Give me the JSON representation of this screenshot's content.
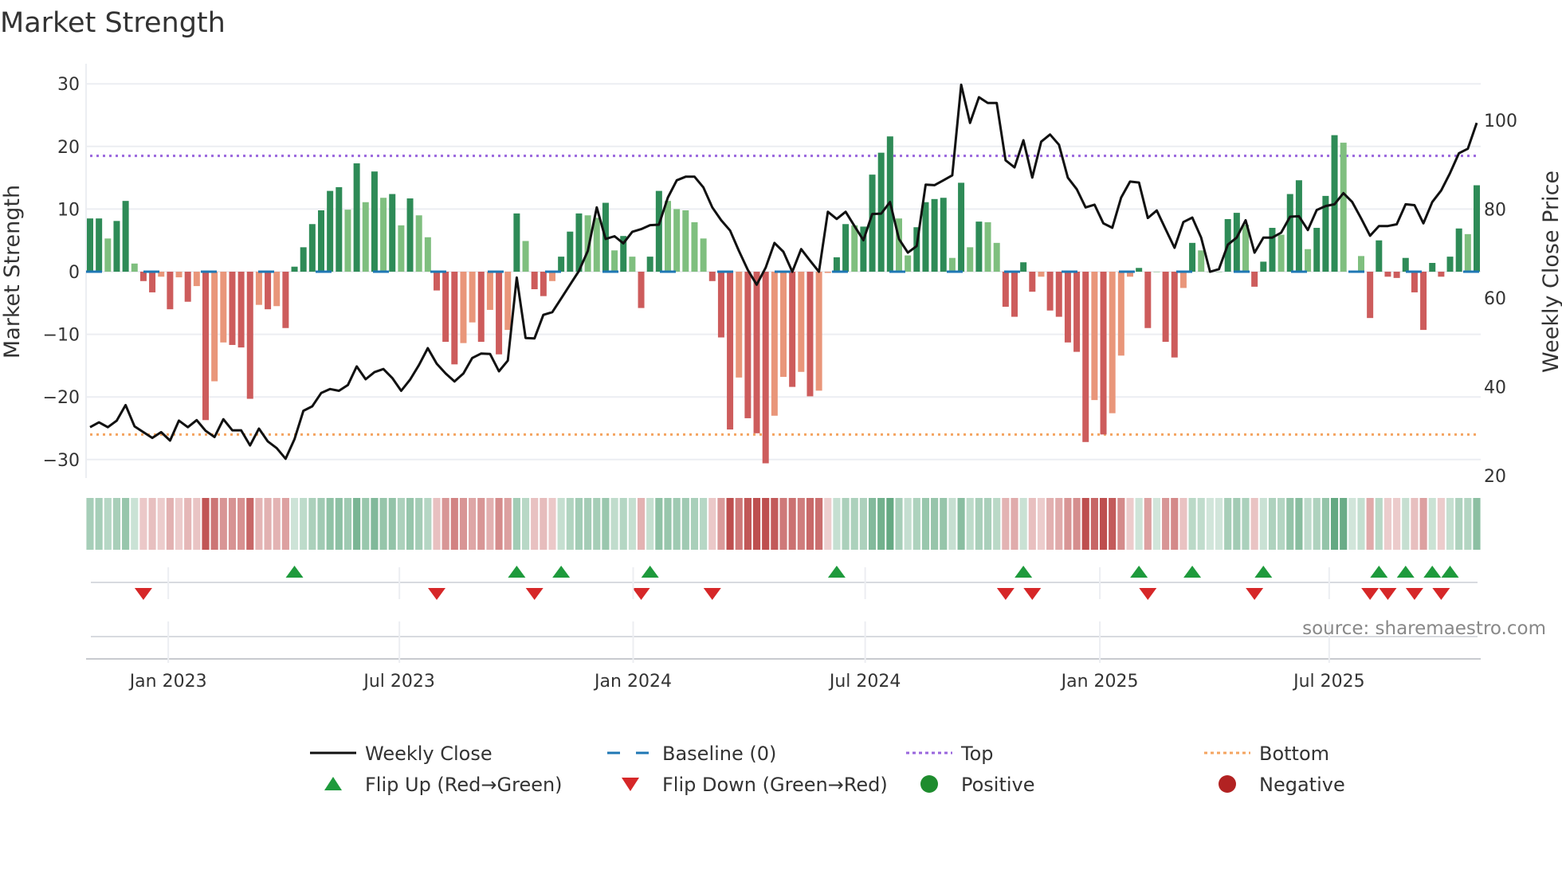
{
  "chart_data": {
    "type": "bar",
    "title": "Market Strength",
    "ylabel": "Market Strength",
    "y2label": "Weekly Close Price",
    "ylim": [
      -33,
      33
    ],
    "y2lim": [
      18,
      110
    ],
    "yticks": [
      30,
      20,
      10,
      0,
      -10,
      -20,
      -30
    ],
    "ytick_labels": [
      "30",
      "20",
      "10",
      "0",
      "−10",
      "−20",
      "−30"
    ],
    "y2ticks": [
      100,
      80,
      60,
      40,
      20
    ],
    "y2tick_labels": [
      "100",
      "80",
      "60",
      "40",
      "20"
    ],
    "top_level": 18.5,
    "bottom_level": -26,
    "xticks": [
      {
        "label": "Jan 2023",
        "week": 9.8
      },
      {
        "label": "Jul 2023",
        "week": 35.8
      },
      {
        "label": "Jan 2024",
        "week": 62.1
      },
      {
        "label": "Jul 2024",
        "week": 88.2
      },
      {
        "label": "Jan 2025",
        "week": 114.6
      },
      {
        "label": "Jul 2025",
        "week": 140.4
      }
    ],
    "strength": [
      8.5,
      8.5,
      5.3,
      8.1,
      11.3,
      1.3,
      -1.5,
      -3.3,
      -0.8,
      -6,
      -0.9,
      -4.8,
      -2.3,
      -23.7,
      -17.5,
      -11.3,
      -11.7,
      -12.1,
      -20.3,
      -5.3,
      -6,
      -5.5,
      -9,
      0.8,
      3.9,
      7.6,
      9.8,
      12.9,
      13.5,
      9.9,
      17.3,
      11.1,
      16,
      11.8,
      12.4,
      7.4,
      11.7,
      9,
      5.5,
      -3,
      -11.2,
      -14.8,
      -11.4,
      -8.1,
      -11.2,
      -6.1,
      -13.2,
      -9.3,
      9.3,
      4.9,
      -2.8,
      -3.9,
      -1.5,
      2.4,
      6.4,
      9.3,
      9,
      8.6,
      11,
      3.4,
      5.7,
      2.4,
      -5.8,
      2.4,
      12.9,
      11.3,
      10,
      9.8,
      7.9,
      5.3,
      -1.5,
      -10.5,
      -25.2,
      -16.9,
      -23.4,
      -25.8,
      -30.6,
      -23,
      -16.8,
      -18.4,
      -16,
      -19.9,
      -19,
      -0.2,
      2.3,
      7.6,
      7.4,
      7.2,
      15.5,
      19,
      21.6,
      8.5,
      2.6,
      7.1,
      11.1,
      11.6,
      11.8,
      2.2,
      14.2,
      3.9,
      8,
      7.9,
      4.6,
      -5.6,
      -7.2,
      1.5,
      -3.2,
      -0.8,
      -6.2,
      -7.2,
      -11.3,
      -12.8,
      -27.2,
      -20.5,
      -26,
      -22.6,
      -13.4,
      -0.8,
      0.6,
      -9,
      0,
      -11.2,
      -13.7,
      -2.6,
      4.6,
      3.4,
      0,
      0,
      8.4,
      9.4,
      7.5,
      -2.4,
      1.6,
      7,
      5.9,
      12.4,
      14.6,
      3.6,
      7,
      12.1,
      21.8,
      20.6,
      0,
      2.5,
      -7.4,
      5,
      -0.8,
      -1,
      2.2,
      -3.3,
      -9.3,
      1.4,
      -0.8,
      2.4,
      6.9,
      6,
      13.8
    ],
    "strong": [
      1,
      1,
      0,
      1,
      1,
      0,
      1,
      1,
      0,
      1,
      0,
      1,
      0,
      1,
      0,
      0,
      1,
      1,
      1,
      0,
      1,
      0,
      1,
      1,
      1,
      1,
      1,
      1,
      1,
      0,
      1,
      0,
      1,
      0,
      1,
      0,
      1,
      0,
      0,
      1,
      1,
      1,
      0,
      0,
      1,
      0,
      1,
      0,
      1,
      0,
      1,
      1,
      0,
      1,
      1,
      1,
      0,
      0,
      1,
      0,
      1,
      0,
      1,
      1,
      1,
      0,
      0,
      0,
      0,
      0,
      1,
      1,
      1,
      0,
      1,
      1,
      1,
      0,
      0,
      1,
      0,
      1,
      0,
      0,
      1,
      1,
      0,
      1,
      1,
      1,
      1,
      0,
      0,
      1,
      1,
      1,
      1,
      0,
      1,
      0,
      1,
      0,
      0,
      1,
      1,
      1,
      1,
      0,
      1,
      1,
      1,
      1,
      1,
      0,
      1,
      0,
      0,
      0,
      1,
      1,
      0,
      1,
      1,
      0,
      1,
      0,
      0,
      0,
      1,
      1,
      0,
      1,
      1,
      1,
      0,
      1,
      1,
      0,
      1,
      1,
      1,
      0,
      0,
      0,
      1,
      1,
      1,
      1,
      1,
      1,
      1,
      1,
      1,
      1,
      1,
      0,
      1
    ],
    "weekly_close": [
      30.9,
      32,
      30.9,
      32.4,
      35.9,
      31.1,
      29.8,
      28.5,
      29.8,
      27.9,
      32.4,
      30.9,
      32.5,
      30.1,
      28.7,
      32.7,
      30.2,
      30.2,
      26.8,
      30.6,
      27.7,
      26.2,
      23.8,
      28.2,
      34.6,
      35.6,
      38.6,
      39.5,
      39.1,
      40.4,
      44.6,
      41.7,
      43.3,
      44,
      42,
      39.1,
      41.6,
      44.9,
      48.7,
      45.2,
      43,
      41.2,
      43,
      46.5,
      47.5,
      47.4,
      43.5,
      45.9,
      64.6,
      51,
      50.9,
      56.2,
      56.8,
      59.9,
      63,
      66.1,
      70.6,
      80.4,
      73.3,
      73.9,
      72.3,
      74.9,
      75.5,
      76.4,
      76.5,
      82.6,
      86.5,
      87.3,
      87.3,
      84.9,
      80.4,
      77.5,
      75.2,
      70.6,
      66.3,
      63,
      66.8,
      72.4,
      70.4,
      65.9,
      71,
      68.4,
      65.9,
      79.4,
      77.8,
      79.4,
      76.2,
      73,
      78.9,
      79,
      81.6,
      73.3,
      70.2,
      71.7,
      85.5,
      85.4,
      86.5,
      87.6,
      108,
      99.4,
      105.2,
      103.9,
      103.9,
      91,
      89.4,
      95.5,
      87.1,
      95.2,
      96.8,
      94.5,
      87.1,
      84.5,
      80.4,
      81,
      76.8,
      75.8,
      82.6,
      86.2,
      86,
      78,
      79.7,
      75.5,
      71.3,
      77.1,
      78.1,
      73.6,
      65.9,
      66.5,
      72,
      73.6,
      77.5,
      70.2,
      73.6,
      73.6,
      74.7,
      78.3,
      78.4,
      75.3,
      79.8,
      80.7,
      81.1,
      83.6,
      81.6,
      77.9,
      74,
      76.2,
      76.2,
      76.6,
      81.1,
      80.9,
      76.8,
      81.6,
      84.2,
      88.1,
      92.6,
      93.6,
      99.4
    ],
    "flip_up_weeks": [
      24,
      49,
      54,
      64,
      85,
      106,
      119,
      125,
      133,
      146,
      149,
      152,
      154
    ],
    "flip_down_weeks": [
      7,
      40,
      51,
      63,
      71,
      104,
      107,
      120,
      132,
      145,
      147,
      150,
      153
    ],
    "colors": {
      "strong_positive": "#2e8b57",
      "weak_positive": "#7fbf7f",
      "strong_negative": "#cd5c5c",
      "weak_negative": "#e9967a",
      "weekly_close": "#111111",
      "baseline": "#1f77b4",
      "top": "#9966dd",
      "bottom": "#f4a460",
      "flip_up": "#1e9a3c",
      "flip_down": "#d62728",
      "positive": "#1e8c2e",
      "negative": "#b22222"
    },
    "legend": [
      {
        "label": "Weekly Close",
        "kind": "line"
      },
      {
        "label": "Baseline (0)",
        "kind": "dash"
      },
      {
        "label": "Top",
        "kind": "dot-top"
      },
      {
        "label": "Bottom",
        "kind": "dot-bottom"
      },
      {
        "label": "Flip Up (Red→Green)",
        "kind": "tri-up"
      },
      {
        "label": "Flip Down (Green→Red)",
        "kind": "tri-down"
      },
      {
        "label": "Positive",
        "kind": "circle-pos"
      },
      {
        "label": "Negative",
        "kind": "circle-neg"
      }
    ],
    "source": "source: sharemaestro.com"
  }
}
